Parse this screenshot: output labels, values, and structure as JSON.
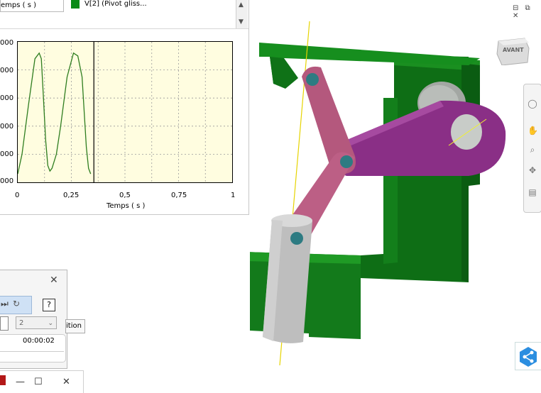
{
  "graph": {
    "legend_left_label": "emps ( s )",
    "legend_right_label": "V[2] (Pivot gliss...",
    "legend_color": "#0a8a17",
    "scroll_up_icon": "chevron-up-icon",
    "scroll_down_icon": "chevron-down-icon",
    "y_ticks": [
      "000",
      "000",
      "000",
      "000",
      "000",
      "000"
    ],
    "x_ticks": [
      "0",
      "0,25",
      "0,5",
      "0,75",
      "1"
    ],
    "x_label": "Temps ( s )"
  },
  "chart_data": {
    "type": "line",
    "xlabel": "Temps ( s )",
    "xlim": [
      0,
      1
    ],
    "x_ticks": [
      0,
      0.25,
      0.5,
      0.75,
      1
    ],
    "grid": true,
    "series": [
      {
        "name": "V[2] (Pivot gliss...",
        "color": "#2e7d1f",
        "x": [
          0.0,
          0.02,
          0.05,
          0.08,
          0.1,
          0.11,
          0.12,
          0.13,
          0.14,
          0.15,
          0.16,
          0.18,
          0.2,
          0.23,
          0.26,
          0.28,
          0.3,
          0.31,
          0.32,
          0.33,
          0.34
        ],
        "y": [
          0.06,
          0.2,
          0.55,
          0.88,
          0.92,
          0.88,
          0.6,
          0.3,
          0.12,
          0.08,
          0.1,
          0.2,
          0.4,
          0.75,
          0.92,
          0.9,
          0.75,
          0.5,
          0.25,
          0.1,
          0.06
        ]
      }
    ],
    "cursor_x": 0.355
  },
  "viewport": {
    "window_controls": "⊟ ⧉ ✕",
    "viewcube_label": "AVANT",
    "nav_icons": [
      "orbit-icon",
      "pan-icon",
      "zoom-icon",
      "look-icon",
      "slider-icon"
    ],
    "share_icon": "share-icon"
  },
  "anim_dialog": {
    "close_label": "✕",
    "help_label": "?",
    "steps_value": "2",
    "time_value": "00:00:02",
    "tooltip_text": "ition"
  },
  "bottom_bar": {
    "minimize_label": "—",
    "maximize_label": "☐",
    "close_label": "✕"
  }
}
